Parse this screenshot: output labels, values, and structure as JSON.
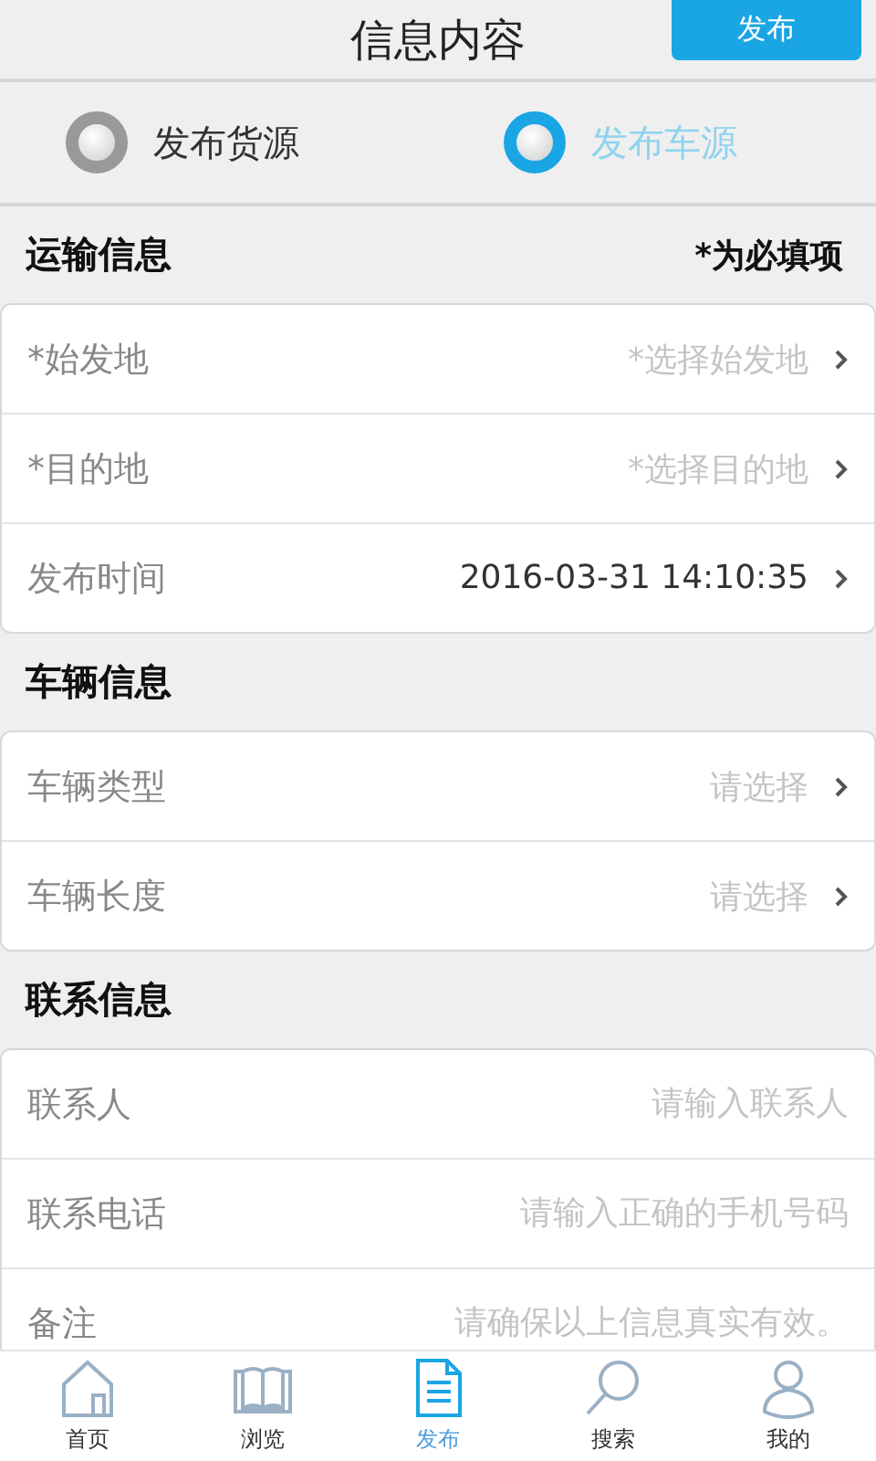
{
  "header": {
    "title": "信息内容",
    "action": "发布"
  },
  "publish_type": [
    {
      "label": "发布货源",
      "selected": false
    },
    {
      "label": "发布车源",
      "selected": true
    }
  ],
  "sections": [
    {
      "title": "运输信息",
      "note": "*为必填项",
      "rows": [
        {
          "kind": "select",
          "label": "*始发地",
          "placeholder": "*选择始发地"
        },
        {
          "kind": "select",
          "label": "*目的地",
          "placeholder": "*选择目的地"
        },
        {
          "kind": "select",
          "label": "发布时间",
          "value": "2016-03-31 14:10:35"
        }
      ]
    },
    {
      "title": "车辆信息",
      "rows": [
        {
          "kind": "select",
          "label": "车辆类型",
          "placeholder": "请选择"
        },
        {
          "kind": "select",
          "label": "车辆长度",
          "placeholder": "请选择"
        }
      ]
    },
    {
      "title": "联系信息",
      "rows": [
        {
          "kind": "input",
          "label": "联系人",
          "placeholder": "请输入联系人"
        },
        {
          "kind": "input",
          "label": "联系电话",
          "placeholder": "请输入正确的手机号码"
        },
        {
          "kind": "input",
          "label": "备注",
          "placeholder": "请确保以上信息真实有效。"
        }
      ]
    }
  ],
  "tab_bar": [
    {
      "kind": "home",
      "label": "首页",
      "selected": false
    },
    {
      "kind": "book",
      "label": "浏览",
      "selected": false
    },
    {
      "kind": "document",
      "label": "发布",
      "selected": true
    },
    {
      "kind": "search",
      "label": "搜索",
      "selected": false
    },
    {
      "kind": "user",
      "label": "我的",
      "selected": false
    }
  ]
}
